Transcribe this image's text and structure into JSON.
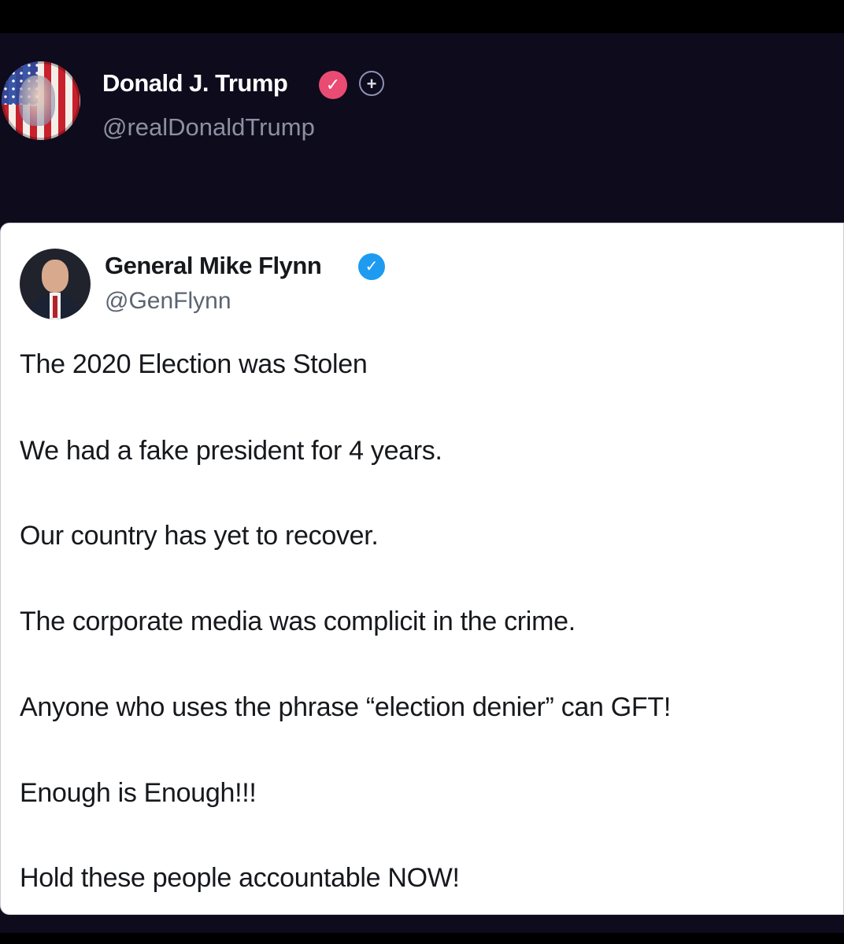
{
  "post": {
    "author_name": "Donald J. Trump",
    "author_handle": "@realDonaldTrump",
    "verified_icon": "check-badge-pink",
    "follow_icon": "plus-icon"
  },
  "quote": {
    "author_name": "General Mike Flynn",
    "author_handle": "@GenFlynn",
    "verified_icon": "check-badge-blue",
    "lines": [
      "The 2020 Election was Stolen",
      "We had a fake president for 4 years.",
      "Our country has yet to recover.",
      "The corporate media was complicit in the crime.",
      "Anyone who uses the phrase “election denier” can GFT!",
      "Enough is Enough!!!",
      "Hold these people accountable NOW!"
    ]
  },
  "colors": {
    "background": "#0d0b1c",
    "card": "#ffffff",
    "pink_badge": "#e94b73",
    "blue_badge": "#1d9bf0"
  }
}
